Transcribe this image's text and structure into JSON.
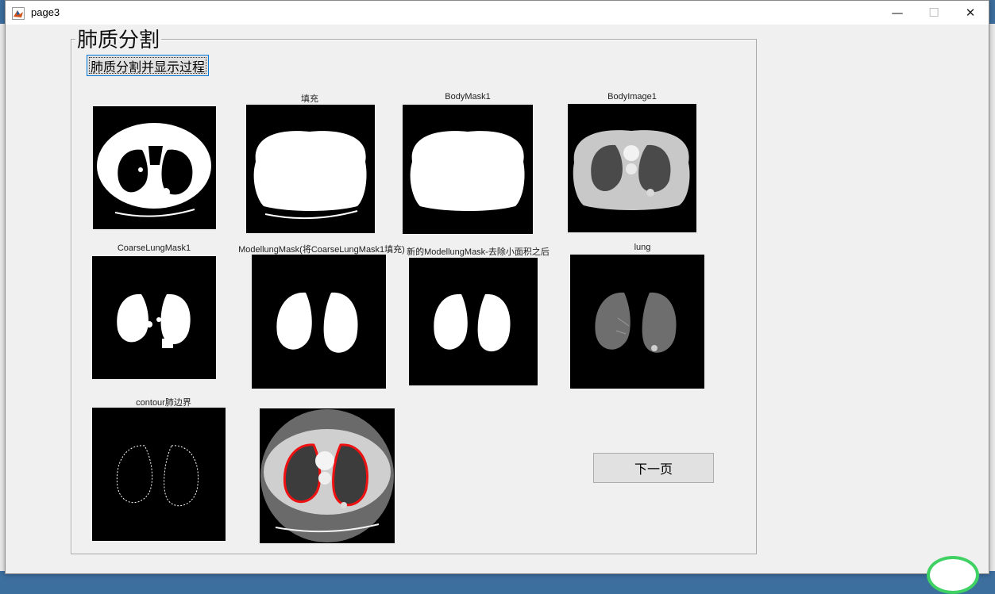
{
  "window": {
    "title": "page3",
    "minimize_glyph": "—",
    "maximize_glyph": "☐",
    "close_glyph": "✕",
    "app_icon": "matlab-icon"
  },
  "panel": {
    "title": "肺质分割"
  },
  "buttons": {
    "show_process": "肺质分割并显示过程",
    "next_page": "下一页"
  },
  "axes": [
    {
      "id": "coarse-threshold",
      "title": ""
    },
    {
      "id": "fill",
      "title": "填充"
    },
    {
      "id": "bodymask1",
      "title": "BodyMask1"
    },
    {
      "id": "bodyimage1",
      "title": "BodyImage1"
    },
    {
      "id": "coarselungmask1",
      "title": "CoarseLungMask1"
    },
    {
      "id": "modellungmask",
      "title": "ModellungMask(将CoarseLungMask1填充)"
    },
    {
      "id": "new-modellungmask",
      "title": "新的ModellungMask-去除小面积之后"
    },
    {
      "id": "lung",
      "title": "lung"
    },
    {
      "id": "contour",
      "title": "contour肺边界"
    },
    {
      "id": "overlay",
      "title": ""
    }
  ],
  "colors": {
    "contour_red": "#ee1111",
    "accent": "#0078d7",
    "window_bg": "#f0f0f0"
  }
}
